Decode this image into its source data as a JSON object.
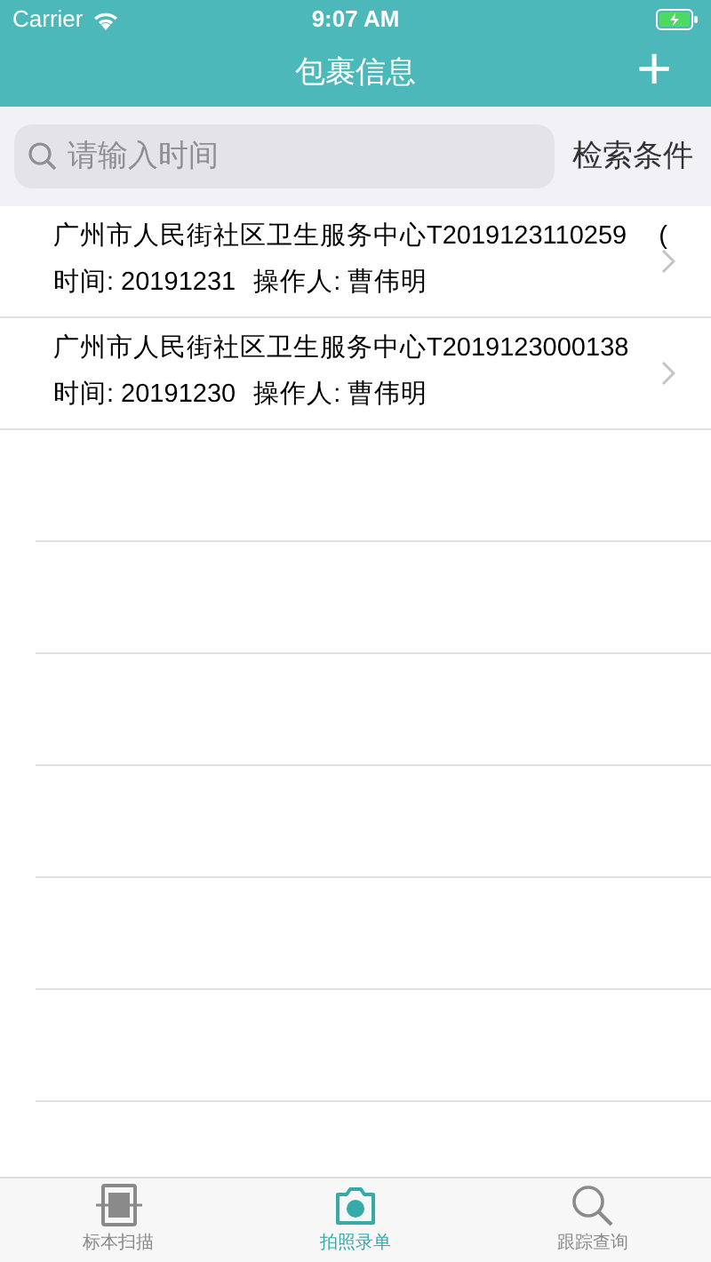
{
  "status_bar": {
    "carrier": "Carrier",
    "time": "9:07 AM"
  },
  "nav": {
    "title": "包裹信息",
    "add": "+"
  },
  "search": {
    "placeholder": "请输入时间",
    "filter_button": "检索条件"
  },
  "records": [
    {
      "title": "广州市人民街社区卫生服务中心T2019123110259",
      "suffix": "(",
      "date": "时间: 20191231",
      "operator": "操作人: 曹伟明"
    },
    {
      "title": "广州市人民街社区卫生服务中心T2019123000138",
      "date": "时间: 20191230",
      "operator": "操作人: 曹伟明"
    }
  ],
  "tabs": [
    {
      "label": "标本扫描",
      "kind": "scan",
      "selected": false
    },
    {
      "label": "拍照录单",
      "kind": "camera",
      "selected": true
    },
    {
      "label": "跟踪查询",
      "kind": "search",
      "selected": false
    }
  ]
}
